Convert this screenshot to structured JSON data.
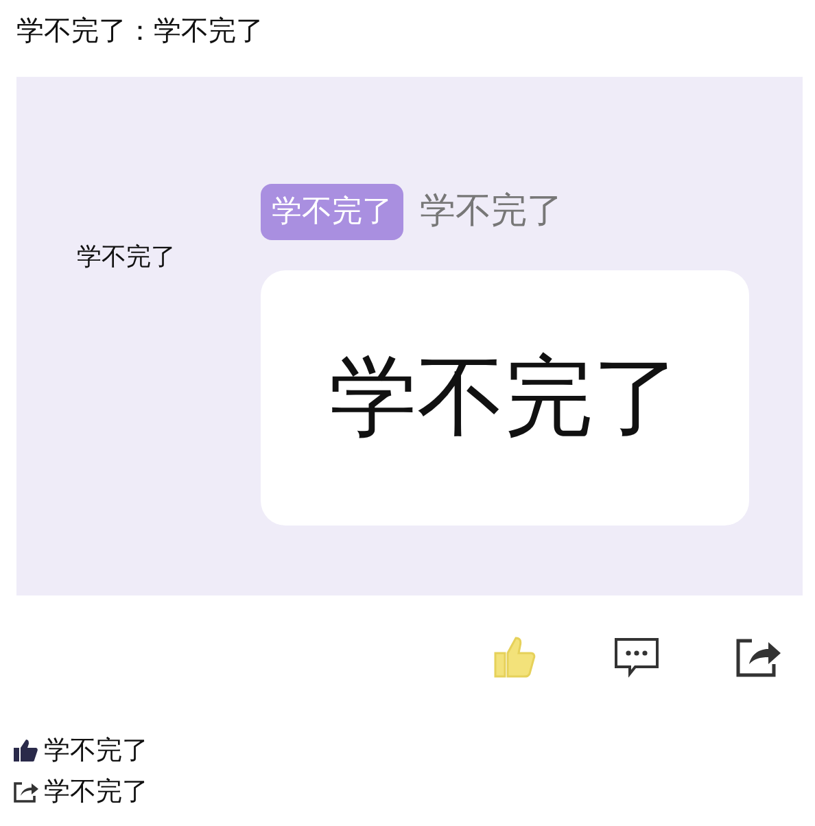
{
  "post": {
    "text": "学不完了：学不完了"
  },
  "image": {
    "side_label": "学不完了",
    "tag": "学不完了",
    "tag_caption": "学不完了",
    "card_text": "学不完了"
  },
  "actions": {
    "liked": true
  },
  "stats": [
    {
      "kind": "likes",
      "text": "学不完了"
    },
    {
      "kind": "shares",
      "text": "学不完了"
    }
  ]
}
